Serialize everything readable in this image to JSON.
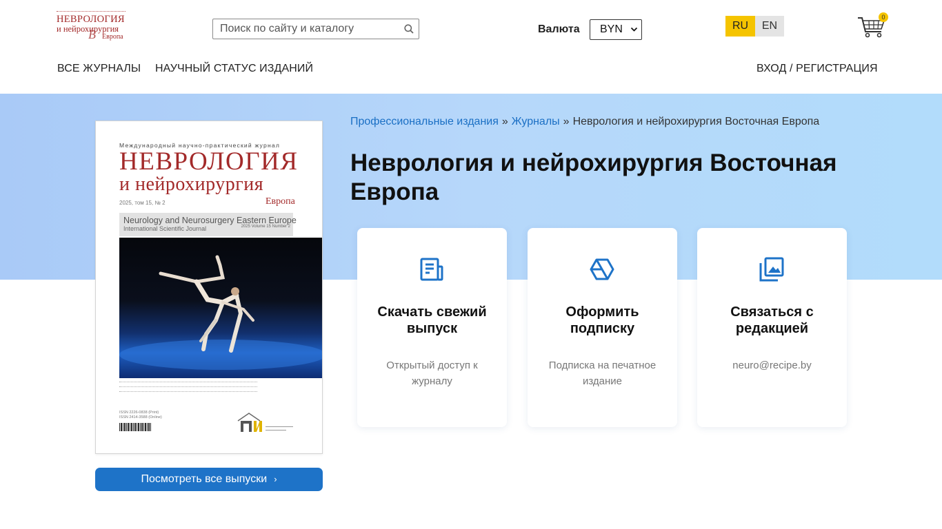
{
  "logo": {
    "line1": "НЕВРОЛОГИЯ",
    "line2": "и нейрохирургия",
    "line3": "Европа"
  },
  "search": {
    "placeholder": "Поиск по сайту и каталогу"
  },
  "currency": {
    "label": "Валюта",
    "selected": "BYN"
  },
  "lang": {
    "ru": "RU",
    "en": "EN",
    "active": "RU"
  },
  "cart": {
    "count": "0"
  },
  "nav": {
    "all_journals": "ВСЕ ЖУРНАЛЫ",
    "scientific_status": "НАУЧНЫЙ СТАТУС ИЗДАНИЙ",
    "login": "ВХОД / РЕГИСТРАЦИЯ"
  },
  "cover": {
    "subtitle": "Международный научно-практический журнал",
    "title1": "НЕВРОЛОГИЯ",
    "title2": "и нейрохирургия",
    "title3": "Европа",
    "issue": "2025, том 15, № 2",
    "en_title": "Neurology and Neurosurgery Eastern Europe",
    "en_sub": "International Scientific Journal",
    "en_issue": "2025  Volume 15  Number 2",
    "isbn": "ISSN 2226-0838 (Print)\nISSN 2414-3588 (Online)"
  },
  "all_issues_button": "Посмотреть все выпуски",
  "breadcrumb": {
    "items": [
      "Профессиональные издания",
      "Журналы"
    ],
    "separator": "»",
    "current": "Неврология и нейрохирургия Восточная Европа"
  },
  "page_title": "Неврология и нейрохирургия Восточная Европа",
  "cards": [
    {
      "icon": "document-icon",
      "title": "Скачать свежий выпуск",
      "desc": "Открытый доступ к журналу"
    },
    {
      "icon": "cube-icon",
      "title": "Оформить подписку",
      "desc": "Подписка на печатное издание"
    },
    {
      "icon": "image-gallery-icon",
      "title": "Связаться с редакцией",
      "desc": "neuro@recipe.by"
    }
  ],
  "colors": {
    "accent": "#1e73c8",
    "brand_red": "#a32a2a",
    "lang_active": "#f5c400",
    "hero_bg": "#b2d3f9"
  }
}
